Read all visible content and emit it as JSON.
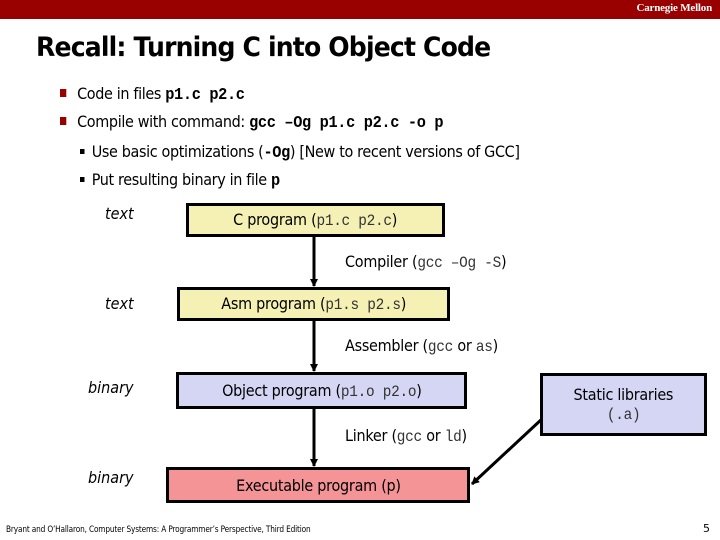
{
  "header": {
    "brand": "Carnegie Mellon",
    "bar_color": "#990000"
  },
  "title": "Recall: Turning C into Object Code",
  "bullets": [
    {
      "text": "Code in files ",
      "code": "p1.c p2.c"
    },
    {
      "text": "Compile with command:  ",
      "code": "gcc –Og p1.c p2.c -o p",
      "sub": [
        {
          "text_before": "Use basic optimizations (",
          "code": "-Og",
          "text_after": ") [New to recent versions of GCC]"
        },
        {
          "text_before": "Put resulting binary in file ",
          "code": "p",
          "text_after": ""
        }
      ]
    }
  ],
  "diagram": {
    "kinds": [
      "text",
      "text",
      "binary",
      "binary"
    ],
    "boxes": {
      "c_program": {
        "label": "C program (",
        "code": "p1.c  p2.c",
        "close": ")",
        "color": "#f5f0b4"
      },
      "asm_program": {
        "label": "Asm program (",
        "code": "p1.s  p2.s",
        "close": ")",
        "color": "#f5f0b4"
      },
      "object_program": {
        "label": "Object program (",
        "code": "p1.o  p2.o",
        "close": ")",
        "color": "#d4d6f4"
      },
      "executable_program": {
        "label": "Executable program (p)",
        "color": "#f59496"
      },
      "static_libraries": {
        "label": "Static libraries",
        "code": "(.a)",
        "color": "#d4d6f4"
      }
    },
    "steps": {
      "compiler": {
        "label": "Compiler (",
        "code": "gcc  –Og  -S",
        "close": ")"
      },
      "assembler": {
        "label": "Assembler (",
        "code": "gcc",
        "mid": " or ",
        "code2": "as",
        "close": ")"
      },
      "linker": {
        "label": "Linker (",
        "code": "gcc",
        "mid": " or  ",
        "code2": "ld",
        "close": ")"
      }
    }
  },
  "footer": {
    "citation": "Bryant and O’Hallaron, Computer Systems: A Programmer’s Perspective, Third Edition",
    "page_number": "5"
  }
}
